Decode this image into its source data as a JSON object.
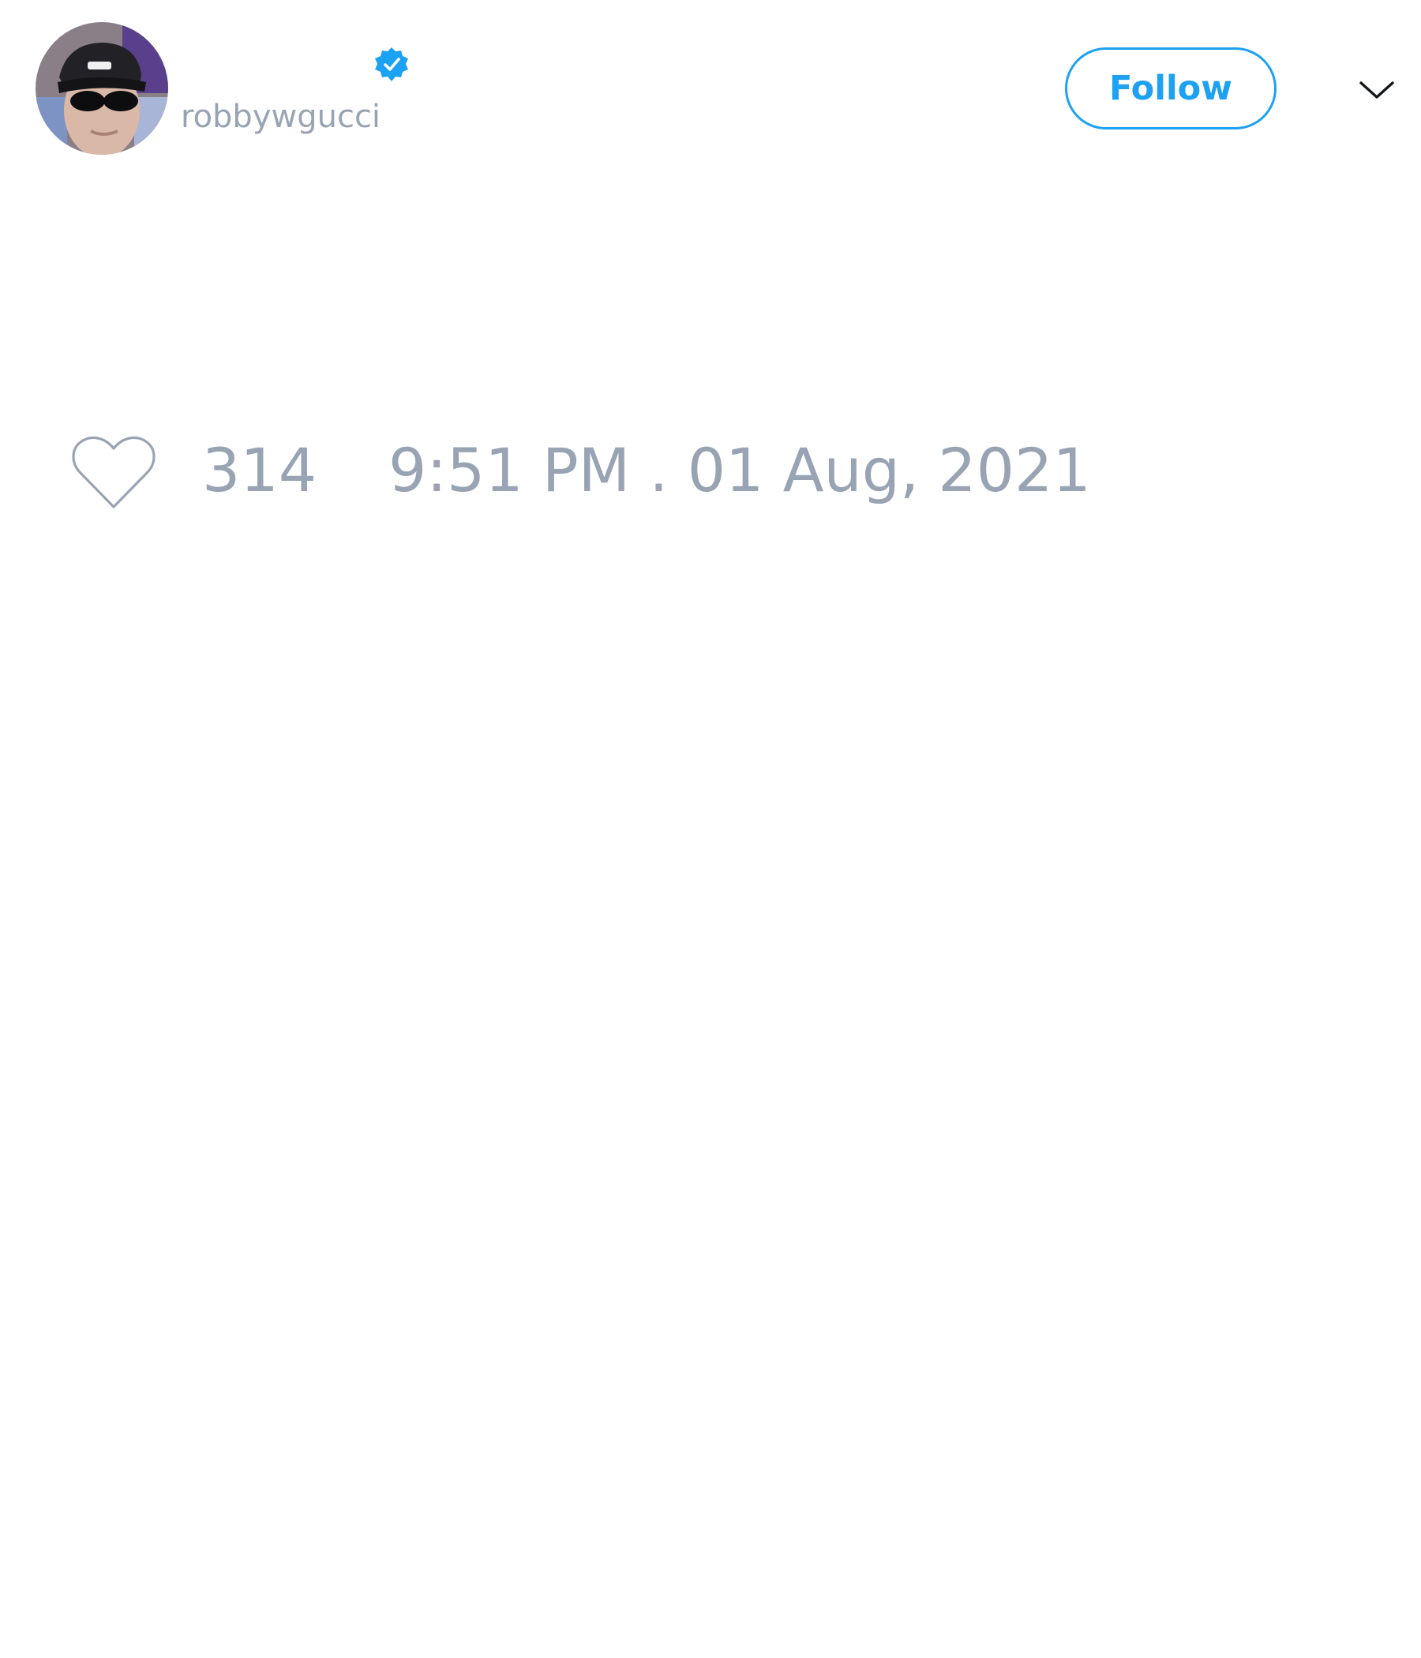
{
  "tweet": {
    "author": {
      "display_name": "",
      "handle": "robbywgucci",
      "verified": true,
      "avatar_icon": "profile-photo"
    },
    "follow_button": {
      "label": "Follow"
    },
    "menu_icon": "chevron-down-icon",
    "stats": {
      "like_icon": "heart-outline-icon",
      "like_count": "314",
      "timestamp": "9:51 PM . 01 Aug, 2021"
    }
  },
  "colors": {
    "accent": "#1da1f2",
    "muted_text": "#98a4b4",
    "background": "#ffffff"
  }
}
